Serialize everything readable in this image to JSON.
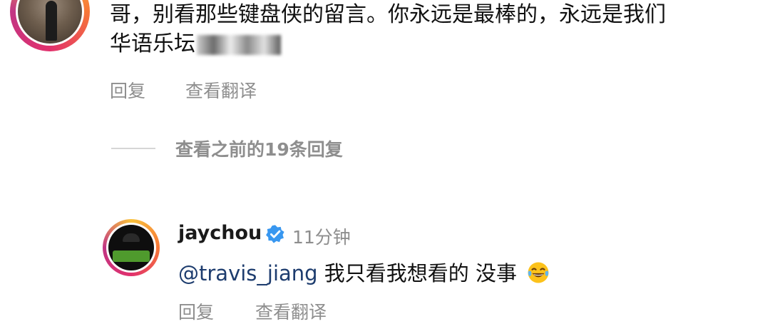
{
  "comment": {
    "text_line1": "哥，别看那些键盘侠的留言。你永远是最棒的，永远是我们",
    "text_line2": "华语乐坛",
    "actions": {
      "reply": "回复",
      "translate": "查看翻译"
    }
  },
  "view_previous_replies": "查看之前的19条回复",
  "reply": {
    "username": "jaychou",
    "verified_icon": "verified-badge-icon",
    "time": "11分钟",
    "mention": "@travis_jiang",
    "text": "我只看我想看的 没事",
    "emoji": "tears-of-joy-emoji",
    "actions": {
      "reply": "回复",
      "translate": "查看翻译"
    }
  },
  "colors": {
    "muted_text": "#8e8e8e",
    "mention": "#1d3c6e",
    "verified_blue": "#3897f0",
    "story_ring_start": "#f9c23c",
    "story_ring_end": "#c13584"
  }
}
